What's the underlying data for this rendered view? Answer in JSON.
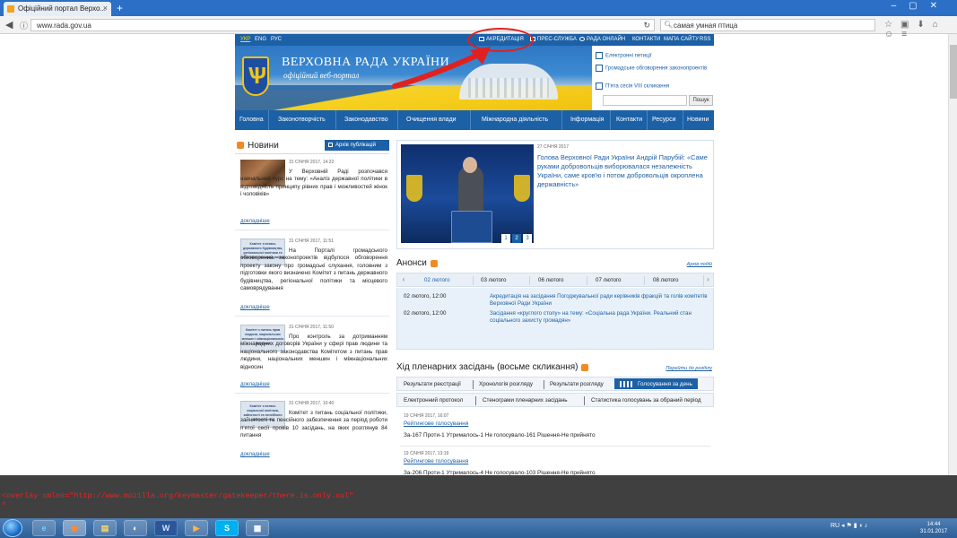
{
  "browser": {
    "tab_title": "Офіційний портал Верхо...",
    "tab_close": "×",
    "new_tab": "+",
    "window_controls": "–▢✕",
    "url": "www.rada.gov.ua",
    "search_query": "самая умная птица",
    "nav_back": "◀",
    "nav_info": "ⓘ",
    "reload": "↻",
    "toolbar_icons": "☆▣⬇⌂☺≡"
  },
  "site": {
    "languages": [
      "УКР",
      "ENG",
      "РУС"
    ],
    "top_links": {
      "accreditation": "АКРЕДИТАЦІЯ",
      "press": "ПРЕС-СЛУЖБА",
      "rada_online": "РАДА ОНЛАЙН",
      "contacts": "КОНТАКТИ",
      "sitemap": "МАПА САЙТУ",
      "rss": "RSS"
    },
    "title": "ВЕРХОВНА РАДА УКРАЇНИ",
    "subtitle": "офіційний веб-портал",
    "trident": "Ѱ",
    "right_links": {
      "petitions": "Електронні петиції",
      "discussion": "Громадське обговорення законопроектів",
      "session": "П'ята сесія VIII скликання"
    },
    "search_button": "Пошук",
    "nav": [
      "Головна",
      "Законотворчість",
      "Законодавство",
      "Очищення влади",
      "Міжнародна діяльність",
      "Інформація",
      "Контакти",
      "Ресурси",
      "Новини"
    ],
    "news": {
      "title": "Новини",
      "archive": "Архів публікацій",
      "more_label": "докладніше",
      "items": [
        {
          "date": "31 СІЧНЯ 2017, 14:22",
          "thumb": "",
          "text": "У Верховній Раді розпочався навчальний курс на тему: «Аналіз державної політики в відповідність принципу рівних прав і можливостей жінок і чоловіків»"
        },
        {
          "date": "31 СІЧНЯ 2017, 11:51",
          "thumb": "Комітет з питань державного будівництва, регіональної політики та місцевого самоврядування",
          "text": "На Порталі громадського обговорення законопроектів відбулося обговорення проекту закону про громадські слухання, головним з підготовки якого визначено Комітет з питань державного будівництва, регіональної політики та місцевого самоврядування"
        },
        {
          "date": "31 СІЧНЯ 2017, 11:50",
          "thumb": "Комітет з питань прав людини, національних меншин і міжнаціональних відносин",
          "text": "Про контроль за дотриманням міжнародних договорів України у сфері прав людини та національного законодавства Комітетом з питань прав людини, національних меншин і міжнаціональних відносин"
        },
        {
          "date": "31 СІЧНЯ 2017, 10:40",
          "thumb": "Комітет з питань соціальної політики, зайнятості та пенсійного забезпечення",
          "text": "Комітет з питань соціальної політики, зайнятості та пенсійного забезпечення за період роботи п'ятої сесії провів 10 засідань, на яких розглянув 84 питання"
        }
      ]
    },
    "featured": {
      "date": "27 СІЧНЯ 2017",
      "text": "Голова Верховної Ради України Андрій Парубій: «Саме руками добровольців виборювалася незалежність України, саме кров'ю і потом добровольців окроплена державність»",
      "pages": [
        "1",
        "2",
        "3"
      ]
    },
    "anons": {
      "title": "Анонси",
      "all_link": "Архів подій",
      "prev": "‹",
      "next": "›",
      "dates": [
        "02 лютого",
        "03 лютого",
        "06 лютого",
        "07 лютого",
        "08 лютого"
      ],
      "events": [
        {
          "time": "02 лютого, 12:00",
          "text": "Акредитація на засідання Погоджувальної ради керівників фракцій та голів комітетів Верховної Ради України"
        },
        {
          "time": "02 лютого, 12:00",
          "text": "Засідання «круглого столу» на тему: «Соціальна рада України. Реальний стан соціального захисту громадян»"
        }
      ]
    },
    "plenary": {
      "title": "Хід пленарних засідань (восьме скликання)",
      "all_link": "Перейти до розділу",
      "tabs_row1": [
        "Результати реєстрації",
        "Хронологія розгляду",
        "Результати розгляду",
        "Голосування за день"
      ],
      "tabs_row2": [
        "Електронний протокол",
        "Стенограми пленарних засідань",
        "Статистика голосувань за обраний період"
      ],
      "votes": [
        {
          "date": "19 СІЧНЯ 2017, 16:07",
          "link": "Рейтингове голосування",
          "result": "За-167 Проти-1 Утрималось-1 Не голосувало-161 Рішення-Не прийнято"
        },
        {
          "date": "19 СІЧНЯ 2017, 13:19",
          "link": "Рейтингове голосування",
          "result": "За-206 Проти-1 Утрималось-4 Не голосувало-103 Рішення-Не прийнято"
        }
      ]
    }
  },
  "console": {
    "text": "<overlay xmlns=\"http://www.mozilla.org/keymaster/gatekeeper/there.is.only.xul\"",
    "caret": "^"
  },
  "taskbar": {
    "apps": [
      "e",
      "◉",
      "▤",
      "◐",
      "W",
      "▶",
      "S",
      "▦"
    ],
    "tray": "RU ◂ ⚑ ▮ ◖ ♪",
    "time": "14:44",
    "date": "31.01.2017"
  },
  "colors": {
    "site_blue": "#1c60a6",
    "annotation_red": "#e0211f",
    "console_text": "#ee2020",
    "console_bg": "#404040"
  }
}
